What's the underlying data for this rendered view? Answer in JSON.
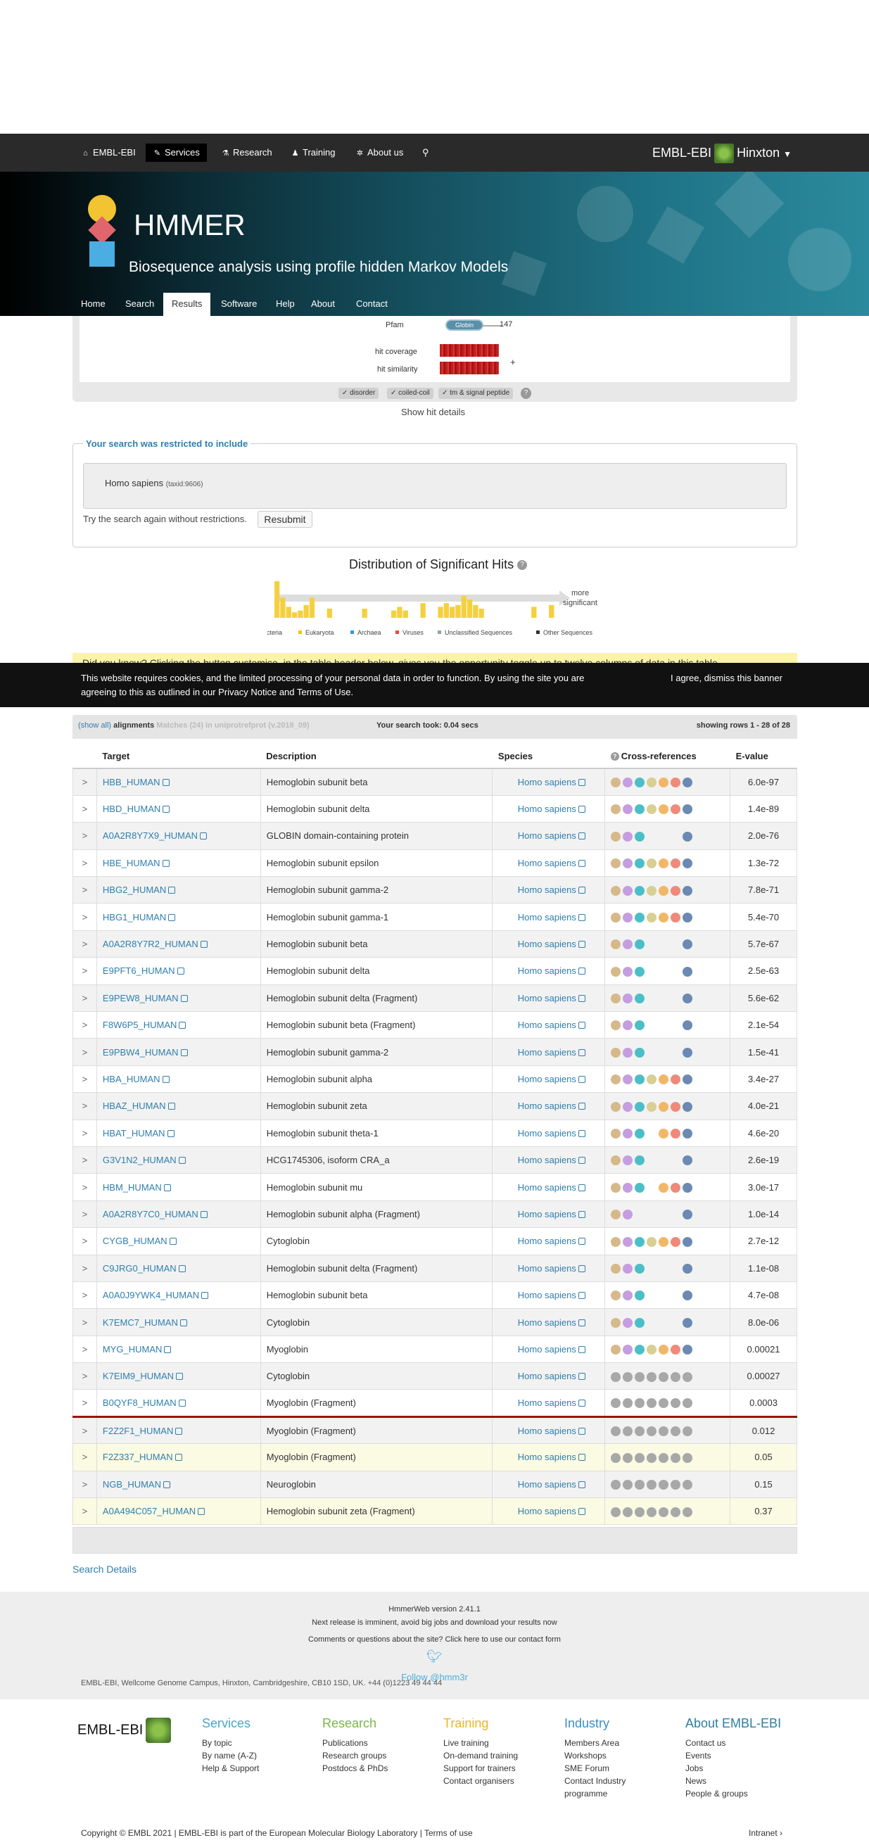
{
  "topnav": {
    "items": [
      {
        "label": "EMBL-EBI",
        "icon": "home-icon"
      },
      {
        "label": "Services",
        "icon": "wrench-icon"
      },
      {
        "label": "Research",
        "icon": "flask-icon"
      },
      {
        "label": "Training",
        "icon": "person-icon"
      },
      {
        "label": "About us",
        "icon": "info-icon"
      }
    ],
    "right_label": "EMBL-EBI",
    "location": "Hinxton"
  },
  "banner": {
    "title": "HMMER",
    "subtitle": "Biosequence analysis using profile hidden Markov Models",
    "nav": [
      "Home",
      "Search",
      "Results",
      "Software",
      "Help",
      "About",
      "Contact"
    ],
    "active_nav": "Results"
  },
  "summary": {
    "pfam_label": "Pfam",
    "pfam_domain": "Globin",
    "seq_end": "147",
    "hit_coverage_label": "hit coverage",
    "hit_similarity_label": "hit similarity",
    "plus": "+",
    "pills": [
      "✓ disorder",
      "✓ coiled-coil",
      "✓ tm & signal peptide"
    ],
    "help": "?",
    "show_hit_details": "Show hit details"
  },
  "restriction": {
    "title": "Your search was restricted to include",
    "species": "Homo sapiens",
    "taxid": "(taxid:9606)",
    "retry_text": "Try the search again without restrictions.",
    "resubmit": "Resubmit"
  },
  "distribution": {
    "title": "Distribution of Significant Hits",
    "help": "?",
    "more_label": "more",
    "significant_label": "significant",
    "legend": [
      {
        "name": "Bacteria",
        "color": "#c0392b"
      },
      {
        "name": "Eukaryota",
        "color": "#f1c40f"
      },
      {
        "name": "Archaea",
        "color": "#3498db"
      },
      {
        "name": "Viruses",
        "color": "#e74c3c"
      },
      {
        "name": "Unclassified Sequences",
        "color": "#95a5a6"
      },
      {
        "name": "Other Sequences",
        "color": "#333333"
      }
    ],
    "bars": [
      1.0,
      0.55,
      0.3,
      0.15,
      0.2,
      0.35,
      0.55,
      0.0,
      0.0,
      0.25,
      0.0,
      0.0,
      0.0,
      0.0,
      0.0,
      0.25,
      0.0,
      0.0,
      0.0,
      0.0,
      0.2,
      0.3,
      0.2,
      0.0,
      0.0,
      0.4,
      0.0,
      0.0,
      0.3,
      0.4,
      0.3,
      0.35,
      0.6,
      0.5,
      0.35,
      0.25,
      0.0,
      0.0,
      0.0,
      0.0,
      0.0,
      0.0,
      0.0,
      0.0,
      0.3,
      0.0,
      0.0,
      0.35
    ]
  },
  "did_you_know": "Did you know? Clicking the button customise, in the table header below, gives you the opportunity toggle up to twelve columns of data in this table",
  "cookie": {
    "text": "This website requires cookies, and the limited processing of your personal data in order to function. By using the site you are agreeing to this as outlined in our Privacy Notice and Terms of Use.",
    "dismiss": "I agree, dismiss this banner"
  },
  "table_header": {
    "show_all": "(show all)",
    "alignments": "alignments",
    "hidden_text": "Matches (24) in uniprotrefprot (v.2018_09)",
    "took": "Your search took: 0.04 secs",
    "rows": "showing rows 1 - 28 of 28"
  },
  "columns": [
    "",
    "Target",
    "Description",
    "Species",
    "Cross-references",
    "E-value"
  ],
  "rows": [
    {
      "target": "HBB_HUMAN",
      "desc": "Hemoglobin subunit beta",
      "species": "Homo sapiens",
      "evalue": "6.0e-97",
      "xref": "full"
    },
    {
      "target": "HBD_HUMAN",
      "desc": "Hemoglobin subunit delta",
      "species": "Homo sapiens",
      "evalue": "1.4e-89",
      "xref": "full"
    },
    {
      "target": "A0A2R8Y7X9_HUMAN",
      "desc": "GLOBIN domain-containing protein",
      "species": "Homo sapiens",
      "evalue": "2.0e-76",
      "xref": "min"
    },
    {
      "target": "HBE_HUMAN",
      "desc": "Hemoglobin subunit epsilon",
      "species": "Homo sapiens",
      "evalue": "1.3e-72",
      "xref": "full"
    },
    {
      "target": "HBG2_HUMAN",
      "desc": "Hemoglobin subunit gamma-2",
      "species": "Homo sapiens",
      "evalue": "7.8e-71",
      "xref": "full"
    },
    {
      "target": "HBG1_HUMAN",
      "desc": "Hemoglobin subunit gamma-1",
      "species": "Homo sapiens",
      "evalue": "5.4e-70",
      "xref": "full"
    },
    {
      "target": "A0A2R8Y7R2_HUMAN",
      "desc": "Hemoglobin subunit beta",
      "species": "Homo sapiens",
      "evalue": "5.7e-67",
      "xref": "min"
    },
    {
      "target": "E9PFT6_HUMAN",
      "desc": "Hemoglobin subunit delta",
      "species": "Homo sapiens",
      "evalue": "2.5e-63",
      "xref": "min"
    },
    {
      "target": "E9PEW8_HUMAN",
      "desc": "Hemoglobin subunit delta (Fragment)",
      "species": "Homo sapiens",
      "evalue": "5.6e-62",
      "xref": "min"
    },
    {
      "target": "F8W6P5_HUMAN",
      "desc": "Hemoglobin subunit beta (Fragment)",
      "species": "Homo sapiens",
      "evalue": "2.1e-54",
      "xref": "min"
    },
    {
      "target": "E9PBW4_HUMAN",
      "desc": "Hemoglobin subunit gamma-2",
      "species": "Homo sapiens",
      "evalue": "1.5e-41",
      "xref": "min"
    },
    {
      "target": "HBA_HUMAN",
      "desc": "Hemoglobin subunit alpha",
      "species": "Homo sapiens",
      "evalue": "3.4e-27",
      "xref": "full"
    },
    {
      "target": "HBAZ_HUMAN",
      "desc": "Hemoglobin subunit zeta",
      "species": "Homo sapiens",
      "evalue": "4.0e-21",
      "xref": "full"
    },
    {
      "target": "HBAT_HUMAN",
      "desc": "Hemoglobin subunit theta-1",
      "species": "Homo sapiens",
      "evalue": "4.6e-20",
      "xref": "nopdb"
    },
    {
      "target": "G3V1N2_HUMAN",
      "desc": "HCG1745306, isoform CRA_a",
      "species": "Homo sapiens",
      "evalue": "2.6e-19",
      "xref": "min"
    },
    {
      "target": "HBM_HUMAN",
      "desc": "Hemoglobin subunit mu",
      "species": "Homo sapiens",
      "evalue": "3.0e-17",
      "xref": "nopdb"
    },
    {
      "target": "A0A2R8Y7C0_HUMAN",
      "desc": "Hemoglobin subunit alpha (Fragment)",
      "species": "Homo sapiens",
      "evalue": "1.0e-14",
      "xref": "min2"
    },
    {
      "target": "CYGB_HUMAN",
      "desc": "Cytoglobin",
      "species": "Homo sapiens",
      "evalue": "2.7e-12",
      "xref": "full"
    },
    {
      "target": "C9JRG0_HUMAN",
      "desc": "Hemoglobin subunit delta (Fragment)",
      "species": "Homo sapiens",
      "evalue": "1.1e-08",
      "xref": "min"
    },
    {
      "target": "A0A0J9YWK4_HUMAN",
      "desc": "Hemoglobin subunit beta",
      "species": "Homo sapiens",
      "evalue": "4.7e-08",
      "xref": "min"
    },
    {
      "target": "K7EMC7_HUMAN",
      "desc": "Cytoglobin",
      "species": "Homo sapiens",
      "evalue": "8.0e-06",
      "xref": "min"
    },
    {
      "target": "MYG_HUMAN",
      "desc": "Myoglobin",
      "species": "Homo sapiens",
      "evalue": "0.00021",
      "xref": "full"
    },
    {
      "target": "K7EIM9_HUMAN",
      "desc": "Cytoglobin",
      "species": "Homo sapiens",
      "evalue": "0.00027",
      "xref": "grey"
    },
    {
      "target": "B0QYF8_HUMAN",
      "desc": "Myoglobin (Fragment)",
      "species": "Homo sapiens",
      "evalue": "0.0003",
      "xref": "grey"
    },
    {
      "target": "F2Z2F1_HUMAN",
      "desc": "Myoglobin (Fragment)",
      "species": "Homo sapiens",
      "evalue": "0.012",
      "xref": "grey"
    },
    {
      "target": "F2Z337_HUMAN",
      "desc": "Myoglobin (Fragment)",
      "species": "Homo sapiens",
      "evalue": "0.05",
      "xref": "grey"
    },
    {
      "target": "NGB_HUMAN",
      "desc": "Neuroglobin",
      "species": "Homo sapiens",
      "evalue": "0.15",
      "xref": "grey"
    },
    {
      "target": "A0A494C057_HUMAN",
      "desc": "Hemoglobin subunit zeta (Fragment)",
      "species": "Homo sapiens",
      "evalue": "0.37",
      "xref": "grey"
    }
  ],
  "xref_colors": {
    "full": [
      "#d6b98a",
      "#c59de0",
      "#4bbfc8",
      "#d8cf94",
      "#f2b766",
      "#ef8a7a",
      "#6b8ab3"
    ],
    "grey": [
      "#a8a8a8",
      "#a8a8a8",
      "#a8a8a8",
      "#a8a8a8",
      "#a8a8a8",
      "#a8a8a8",
      "#a8a8a8"
    ]
  },
  "search_details": "Search Details",
  "footer": {
    "version": "HmmerWeb version 2.41.1",
    "release": "Next release is imminent, avoid big jobs and download your results now",
    "contact": "Comments or questions about the site? Click here to use our contact form",
    "follow": "Follow @hmm3r"
  },
  "global_footer": {
    "logo": "EMBL-EBI",
    "columns": [
      {
        "title": "Services",
        "color": "#4aa6c8",
        "items": [
          "By topic",
          "By name (A-Z)",
          "Help & Support"
        ]
      },
      {
        "title": "Research",
        "color": "#7ab648",
        "items": [
          "Publications",
          "Research groups",
          "Postdocs & PhDs"
        ]
      },
      {
        "title": "Training",
        "color": "#f0b429",
        "items": [
          "Live training",
          "On-demand training",
          "Support for trainers",
          "Contact organisers"
        ]
      },
      {
        "title": "Industry",
        "color": "#3b8ec4",
        "items": [
          "Members Area",
          "Workshops",
          "SME Forum",
          "Contact Industry",
          "programme"
        ]
      },
      {
        "title": "About EMBL-EBI",
        "color": "#2b7fa0",
        "items": [
          "Contact us",
          "Events",
          "Jobs",
          "News",
          "People & groups"
        ]
      }
    ],
    "address": "EMBL-EBI, Wellcome Genome Campus, Hinxton, Cambridgeshire, CB10 1SD, UK. +44 (0)1223 49 44 44",
    "copyright": "Copyright © EMBL 2021 | EMBL-EBI is part of the European Molecular Biology Laboratory | Terms of use",
    "intranet": "Intranet ›"
  }
}
